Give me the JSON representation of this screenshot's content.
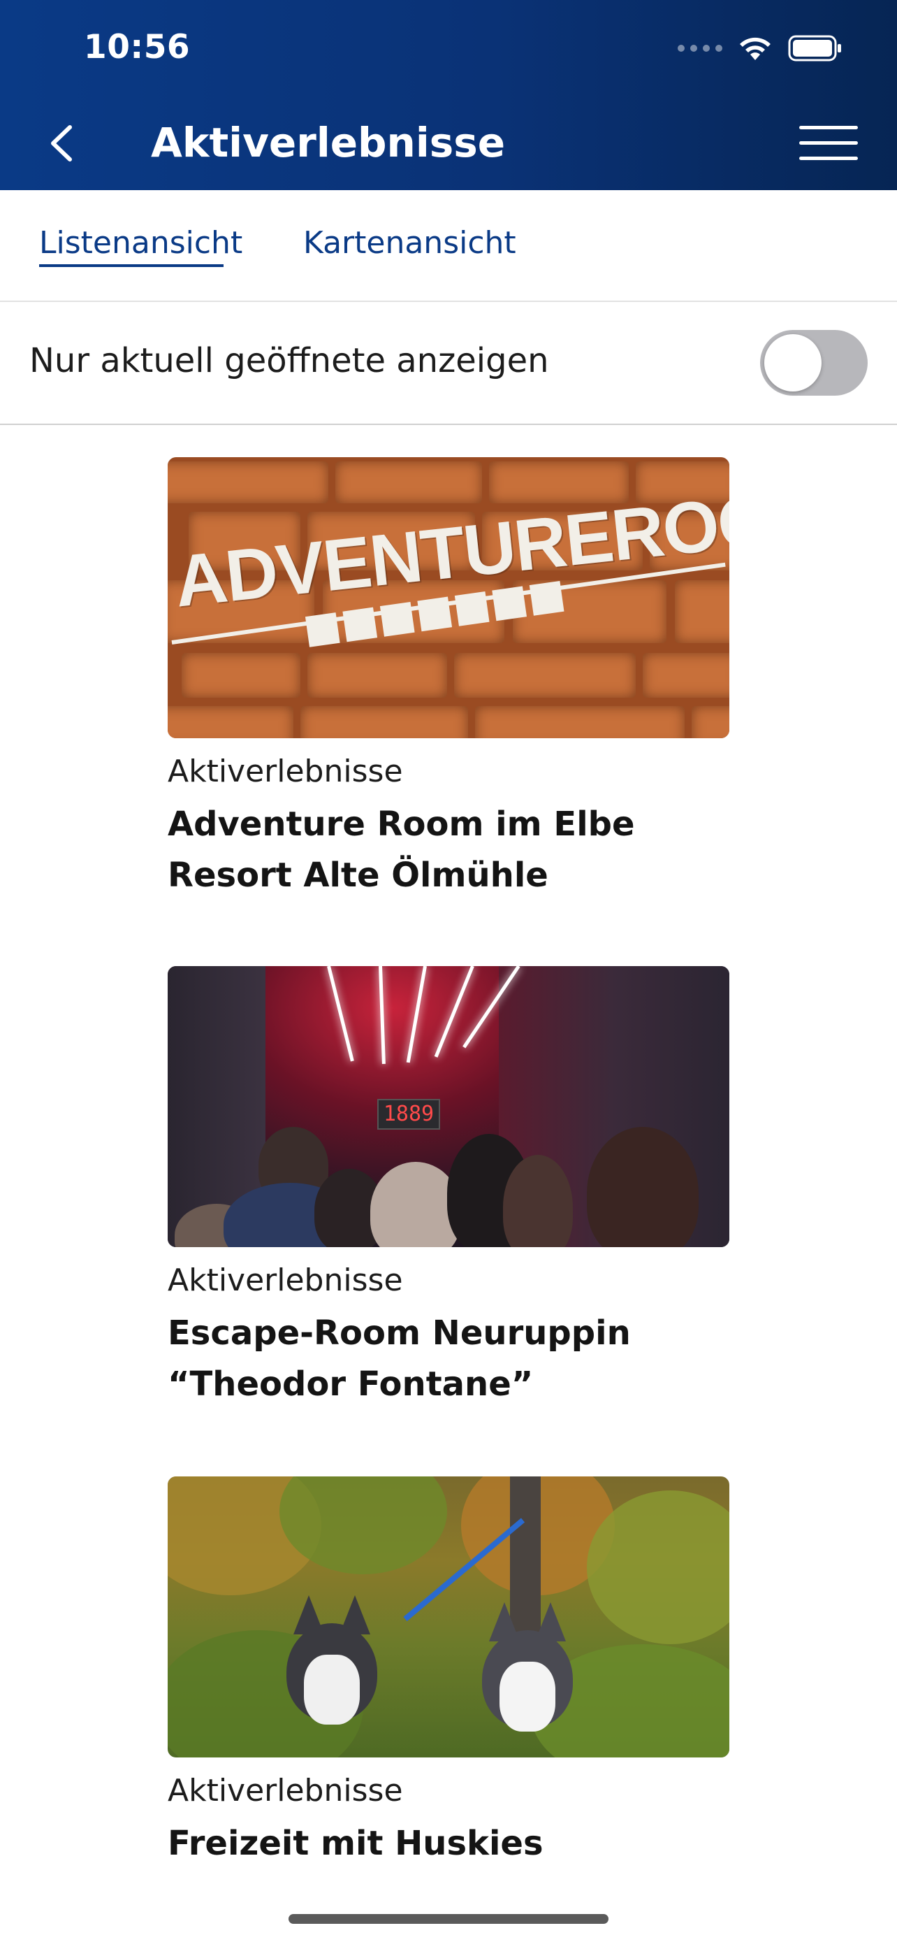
{
  "status_bar": {
    "time": "10:56"
  },
  "header": {
    "title": "Aktiverlebnisse",
    "back_icon": "chevron-left-icon",
    "menu_icon": "hamburger-menu-icon",
    "background_color": "#0a3a86"
  },
  "tabs": [
    {
      "label": "Listenansicht",
      "active": true
    },
    {
      "label": "Kartenansicht",
      "active": false
    }
  ],
  "filter": {
    "label": "Nur aktuell geöffnete anzeigen",
    "toggle_on": false
  },
  "items": [
    {
      "category": "Aktiverlebnisse",
      "title": "Adventure Room im Elbe Resort Alte Ölmühle",
      "image_text": "ADVENTUREROOMS"
    },
    {
      "category": "Aktiverlebnisse",
      "title": "Escape-Room Neuruppin “Theodor Fontane”",
      "image_text": "1889"
    },
    {
      "category": "Aktiverlebnisse",
      "title": "Freizeit mit Huskies"
    }
  ]
}
